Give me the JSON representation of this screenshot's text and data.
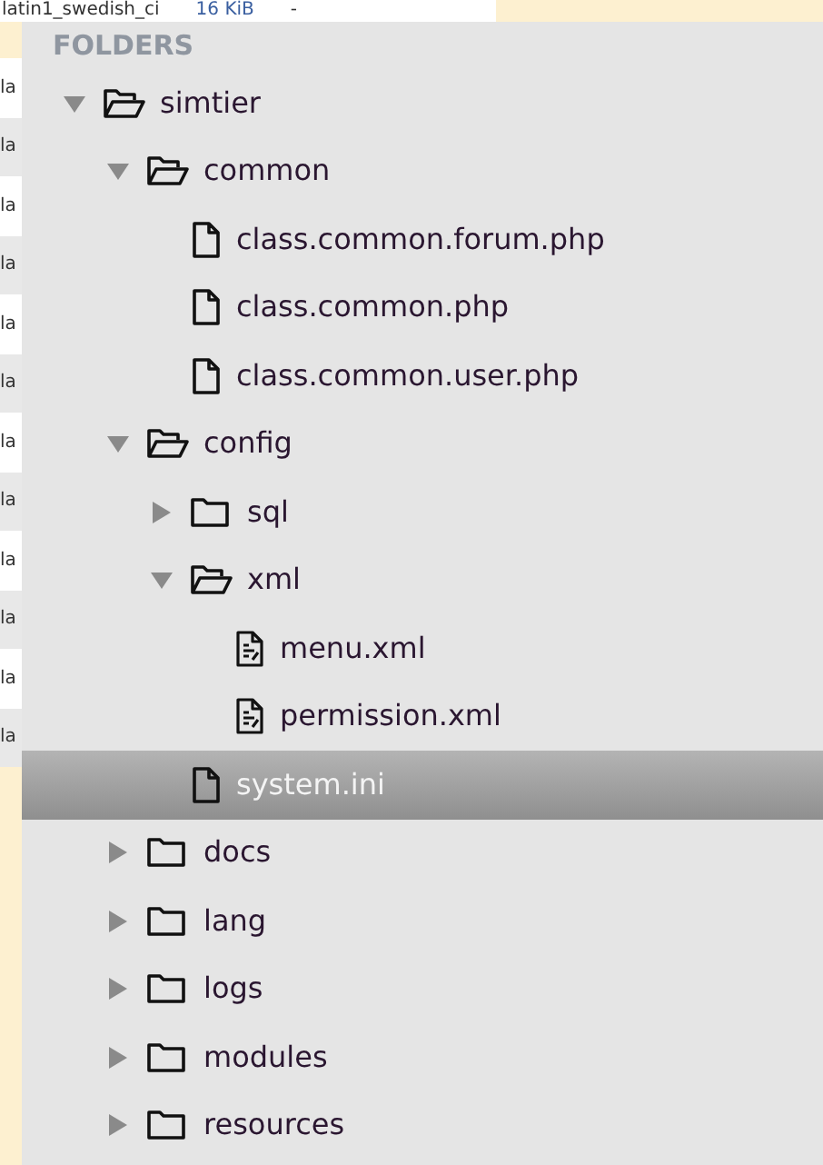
{
  "background_window": {
    "top_row": [
      "latin1_swedish_ci",
      "16 KiB",
      "-"
    ],
    "left_cells": [
      "la",
      "la",
      "la",
      "la",
      "la",
      "la",
      "la",
      "la",
      "la",
      "la",
      "la",
      "la"
    ]
  },
  "sidebar": {
    "header": "FOLDERS",
    "tree": [
      {
        "kind": "folder",
        "name": "simtier",
        "expanded": true,
        "selected": false,
        "children": [
          {
            "kind": "folder",
            "name": "common",
            "expanded": true,
            "selected": false,
            "children": [
              {
                "kind": "file",
                "name": "class.common.forum.php",
                "selected": false
              },
              {
                "kind": "file",
                "name": "class.common.php",
                "selected": false
              },
              {
                "kind": "file",
                "name": "class.common.user.php",
                "selected": false
              }
            ]
          },
          {
            "kind": "folder",
            "name": "config",
            "expanded": true,
            "selected": false,
            "children": [
              {
                "kind": "folder",
                "name": "sql",
                "expanded": false,
                "selected": false
              },
              {
                "kind": "folder",
                "name": "xml",
                "expanded": true,
                "selected": false,
                "children": [
                  {
                    "kind": "xml-file",
                    "name": "menu.xml",
                    "selected": false
                  },
                  {
                    "kind": "xml-file",
                    "name": "permission.xml",
                    "selected": false
                  }
                ]
              },
              {
                "kind": "file",
                "name": "system.ini",
                "selected": true
              }
            ]
          },
          {
            "kind": "folder",
            "name": "docs",
            "expanded": false,
            "selected": false
          },
          {
            "kind": "folder",
            "name": "lang",
            "expanded": false,
            "selected": false
          },
          {
            "kind": "folder",
            "name": "logs",
            "expanded": false,
            "selected": false
          },
          {
            "kind": "folder",
            "name": "modules",
            "expanded": false,
            "selected": false
          },
          {
            "kind": "folder",
            "name": "resources",
            "expanded": false,
            "selected": false
          }
        ]
      }
    ]
  }
}
